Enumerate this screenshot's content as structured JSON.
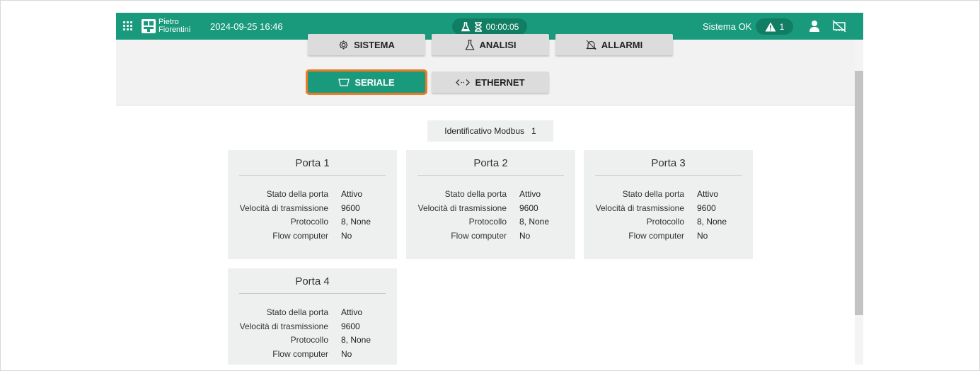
{
  "topbar": {
    "logo_line1": "Pietro",
    "logo_line2": "Fiorentini",
    "datetime": "2024-09-25 16:46",
    "timer": "00:00:05",
    "status": "Sistema OK",
    "alarm_count": "1"
  },
  "nav": {
    "sistema": "SISTEMA",
    "analisi": "ANALISI",
    "allarmi": "ALLARMI",
    "seriale": "SERIALE",
    "ethernet": "ETHERNET"
  },
  "modbus": {
    "label": "Identificativo Modbus",
    "value": "1"
  },
  "ports": [
    {
      "title": "Porta 1",
      "rows": [
        {
          "label": "Stato della porta",
          "value": "Attivo"
        },
        {
          "label": "Velocità di trasmissione",
          "value": "9600"
        },
        {
          "label": "Protocollo",
          "value": "8, None"
        },
        {
          "label": "Flow computer",
          "value": "No"
        }
      ]
    },
    {
      "title": "Porta 2",
      "rows": [
        {
          "label": "Stato della porta",
          "value": "Attivo"
        },
        {
          "label": "Velocità di trasmissione",
          "value": "9600"
        },
        {
          "label": "Protocollo",
          "value": "8, None"
        },
        {
          "label": "Flow computer",
          "value": "No"
        }
      ]
    },
    {
      "title": "Porta 3",
      "rows": [
        {
          "label": "Stato della porta",
          "value": "Attivo"
        },
        {
          "label": "Velocità di trasmissione",
          "value": "9600"
        },
        {
          "label": "Protocollo",
          "value": "8, None"
        },
        {
          "label": "Flow computer",
          "value": "No"
        }
      ]
    },
    {
      "title": "Porta 4",
      "rows": [
        {
          "label": "Stato della porta",
          "value": "Attivo"
        },
        {
          "label": "Velocità di trasmissione",
          "value": "9600"
        },
        {
          "label": "Protocollo",
          "value": "8, None"
        },
        {
          "label": "Flow computer",
          "value": "No"
        }
      ]
    }
  ],
  "colors": {
    "accent": "#1a9a7d",
    "accent_dark": "#117e64",
    "highlight": "#ec7a27"
  },
  "icons": [
    "apps-grid-icon",
    "flask-icon",
    "hourglass-icon",
    "warning-icon",
    "user-icon",
    "network-off-icon",
    "gear-icon",
    "flask-icon",
    "bell-icon",
    "serial-port-icon",
    "ethernet-icon"
  ]
}
